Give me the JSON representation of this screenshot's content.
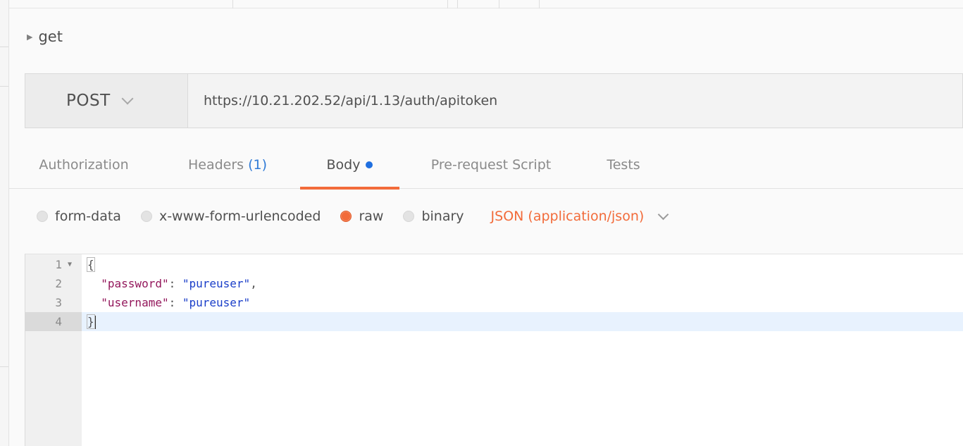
{
  "request": {
    "name": "get"
  },
  "url_bar": {
    "method": "POST",
    "url": "https://10.21.202.52/api/1.13/auth/apitoken"
  },
  "tabs": [
    {
      "label": "Authorization"
    },
    {
      "label": "Headers",
      "count": "(1)"
    },
    {
      "label": "Body",
      "active": true
    },
    {
      "label": "Pre-request Script"
    },
    {
      "label": "Tests"
    }
  ],
  "body_types": {
    "options": [
      "form-data",
      "x-www-form-urlencoded",
      "raw",
      "binary"
    ],
    "selected": "raw",
    "content_type": "JSON (application/json)"
  },
  "editor": {
    "lines": [
      {
        "number": "1",
        "text": "{"
      },
      {
        "number": "2",
        "key": "\"password\"",
        "value": "\"pureuser\"",
        "trail": ","
      },
      {
        "number": "3",
        "key": "\"username\"",
        "value": "\"pureuser\""
      },
      {
        "number": "4",
        "text": "}"
      }
    ]
  },
  "colors": {
    "accent": "#f26b3a",
    "active_tab_dot": "#1f6fe0",
    "header_count": "#2f7ad6",
    "json_key": "#93175b",
    "json_string": "#1a3ec9"
  },
  "icons": {
    "expand": "caret-right-icon",
    "method_dropdown": "chevron-down-icon",
    "content_type_dropdown": "chevron-down-icon",
    "fold": "fold-caret-icon"
  }
}
